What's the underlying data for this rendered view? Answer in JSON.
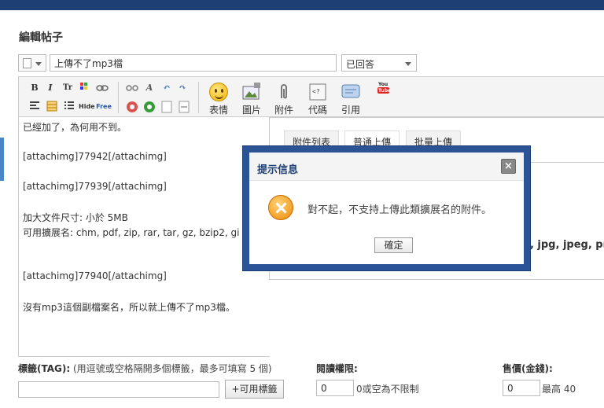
{
  "page": {
    "title": "編輯帖子"
  },
  "subject": {
    "value": "上傳不了mp3檔"
  },
  "status_select": {
    "value": "已回答"
  },
  "toolbar": {
    "emoji_label": "表情",
    "image_label": "圖片",
    "attach_label": "附件",
    "code_label": "代碼",
    "quote_label": "引用",
    "youtube_label": "You Tube"
  },
  "editor": {
    "lines": [
      "已經加了，為何用不到。",
      "[attachimg]77942[/attachimg]",
      "[attachimg]77939[/attachimg]",
      "加大文件尺寸: 小於 5MB",
      "可用擴展名: chm, pdf, zip, rar, tar, gz, bzip2, gi",
      "[attachimg]77940[/attachimg]",
      "沒有mp3這個副檔案名，所以就上傳不了mp3檔。"
    ]
  },
  "attach_panel": {
    "tabs": [
      "附件列表",
      "普通上傳",
      "批量上傳"
    ],
    "ext_fragment": "f, jpg, jpeg, pn"
  },
  "dialog": {
    "title": "提示信息",
    "close_glyph": "×",
    "message": "對不起，不支持上傳此類擴展名的附件。",
    "ok_label": "確定"
  },
  "tags": {
    "label_bold": "標籤(TAG):",
    "label_hint": " (用逗號或空格隔開多個標籤，最多可填寫 5 個)",
    "add_button": "+可用標籤"
  },
  "read_perm": {
    "label": "閱讀權限:",
    "value": "0",
    "note": "0或空為不限制"
  },
  "price": {
    "label": "售價(金錢):",
    "value": "0",
    "note": "最高 40"
  }
}
